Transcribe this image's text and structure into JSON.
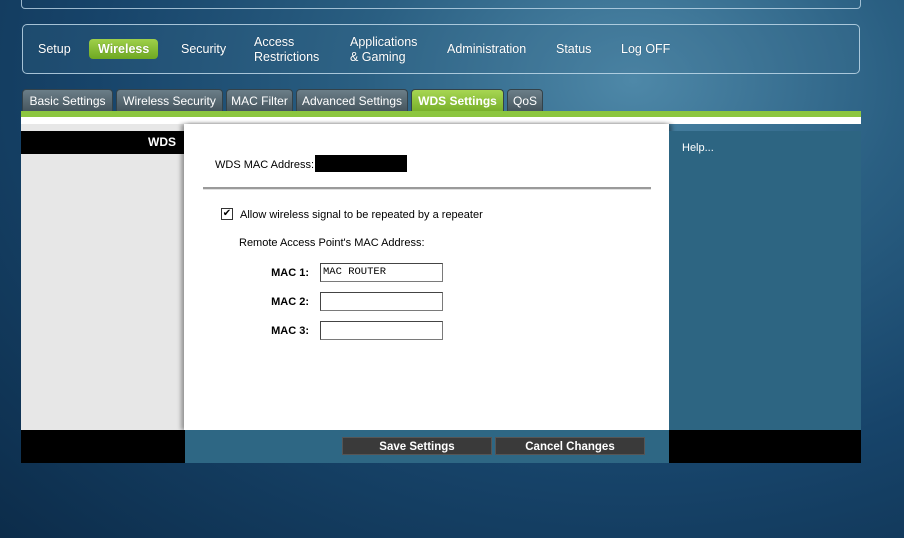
{
  "main_nav": {
    "setup": "Setup",
    "wireless": "Wireless",
    "security": "Security",
    "access_line1": "Access",
    "access_line2": "Restrictions",
    "apps_line1": "Applications",
    "apps_line2": "& Gaming",
    "administration": "Administration",
    "status": "Status",
    "logoff": "Log OFF",
    "active": "Wireless"
  },
  "sub_tabs": [
    "Basic Settings",
    "Wireless Security",
    "MAC Filter",
    "Advanced Settings",
    "WDS Settings",
    "QoS"
  ],
  "active_sub_tab": "WDS Settings",
  "section_title": "WDS",
  "wds_mac_label": "WDS MAC Address:",
  "repeater_checkbox": {
    "label": "Allow wireless signal to be repeated by a repeater",
    "checked": true,
    "glyph": "✔"
  },
  "remote_ap_label": "Remote Access Point's MAC Address:",
  "mac_fields": [
    {
      "label": "MAC 1:",
      "value": "MAC ROUTER"
    },
    {
      "label": "MAC 2:",
      "value": ""
    },
    {
      "label": "MAC 3:",
      "value": ""
    }
  ],
  "help_link": "Help...",
  "buttons": {
    "save": "Save Settings",
    "cancel": "Cancel Changes"
  },
  "colors": {
    "accent_green": "#8cc63f",
    "help_panel": "#2d6582"
  }
}
